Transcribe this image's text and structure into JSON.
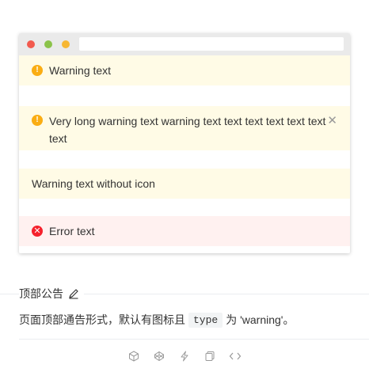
{
  "notices": [
    {
      "type": "warning",
      "text": "Warning text",
      "icon": "warning-circle-icon"
    },
    {
      "type": "warning",
      "text": "Very long warning text warning text text text text text text text",
      "icon": "warning-circle-icon",
      "closable": true
    },
    {
      "type": "warning",
      "text": "Warning text without icon"
    },
    {
      "type": "error",
      "text": "Error text",
      "icon": "error-circle-icon"
    }
  ],
  "section": {
    "title": "顶部公告",
    "desc_before": "页面顶部通告形式，默认有图标且",
    "code": "type",
    "desc_after": "为 'warning'。"
  },
  "icons": {
    "warning_glyph": "!",
    "error_glyph": "✕",
    "close_glyph": "✕"
  },
  "colors": {
    "warning_bg": "#fffbe6",
    "warning_icon": "#faad14",
    "error_bg": "#fff1f0",
    "error_icon": "#f5222d"
  }
}
